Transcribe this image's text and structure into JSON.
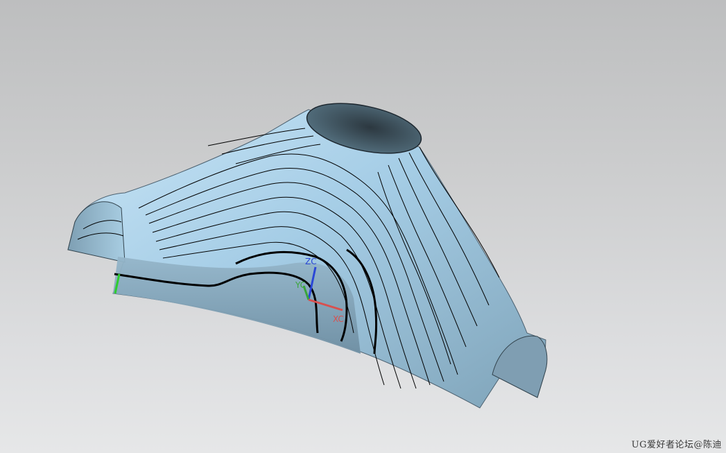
{
  "viewport": {
    "background_top": "#bdbebf",
    "background_bottom": "#e6e7e8"
  },
  "model": {
    "surface_color": "#9cc3dc",
    "surface_highlight": "#c8e4f4",
    "surface_shadow": "#6f8fa3",
    "opening_color": "#3d4e5a",
    "contour_color": "#000000"
  },
  "triad": {
    "z_label": "ZC",
    "y_label": "YC",
    "x_label": "XC",
    "z_color": "#2a47d6",
    "y_color": "#3aa63a",
    "x_color": "#d8504f"
  },
  "watermark": {
    "text": "UG爱好者论坛@陈迪"
  }
}
